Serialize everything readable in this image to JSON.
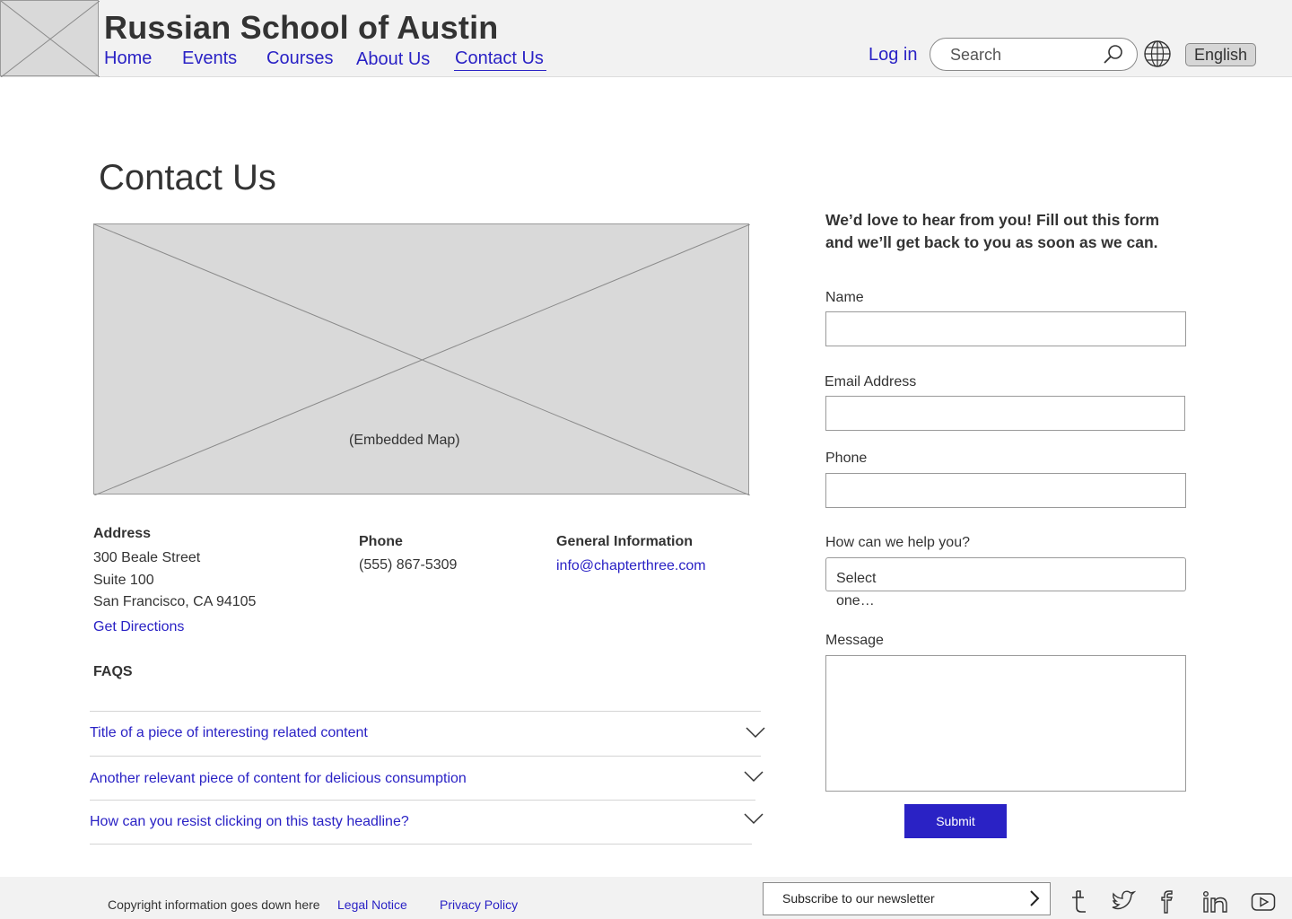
{
  "header": {
    "site_title": "Russian School of Austin",
    "logo_icon": "image-placeholder-icon",
    "nav": [
      {
        "label": "Home"
      },
      {
        "label": "Events"
      },
      {
        "label": "Courses"
      },
      {
        "label": "About Us"
      },
      {
        "label": "Contact Us",
        "active": true
      }
    ],
    "login_label": "Log in",
    "search_placeholder": "Search",
    "search_icon": "search-icon",
    "globe_icon": "globe-icon",
    "language_label": "English"
  },
  "main": {
    "page_title": "Contact Us",
    "map_caption": "(Embedded Map)",
    "address": {
      "heading": "Address",
      "line1": "300 Beale Street",
      "line2": "Suite 100",
      "line3": "San Francisco, CA 94105",
      "directions_link": "Get Directions"
    },
    "phone": {
      "heading": "Phone",
      "value": "(555) 867-5309"
    },
    "general": {
      "heading": "General Information",
      "email": "info@chapterthree.com"
    },
    "faqs": {
      "heading": "FAQS",
      "items": [
        {
          "title": "Title of a piece of interesting related content"
        },
        {
          "title": "Another relevant piece of content for delicious consumption"
        },
        {
          "title": "How can you resist clicking on this tasty headline?"
        }
      ]
    }
  },
  "form": {
    "intro": "We’d love to hear from you! Fill out this form and we’ll get back to you as soon as we can.",
    "name_label": "Name",
    "email_label": "Email Address",
    "phone_label": "Phone",
    "help_label": "How can we help you?",
    "help_select_value": "Select one…",
    "message_label": "Message",
    "submit_label": "Submit"
  },
  "footer": {
    "copyright": "Copyright information goes down here",
    "legal_link": "Legal Notice",
    "privacy_link": "Privacy Policy",
    "newsletter_label": "Subscribe to our newsletter",
    "social_icons": [
      "tumblr-icon",
      "twitter-icon",
      "facebook-icon",
      "linkedin-icon",
      "youtube-icon"
    ]
  },
  "colors": {
    "link": "#2a22c5",
    "button": "#2a22c5",
    "header_bg": "#f2f2f2",
    "placeholder_bg": "#d9d9d9"
  }
}
